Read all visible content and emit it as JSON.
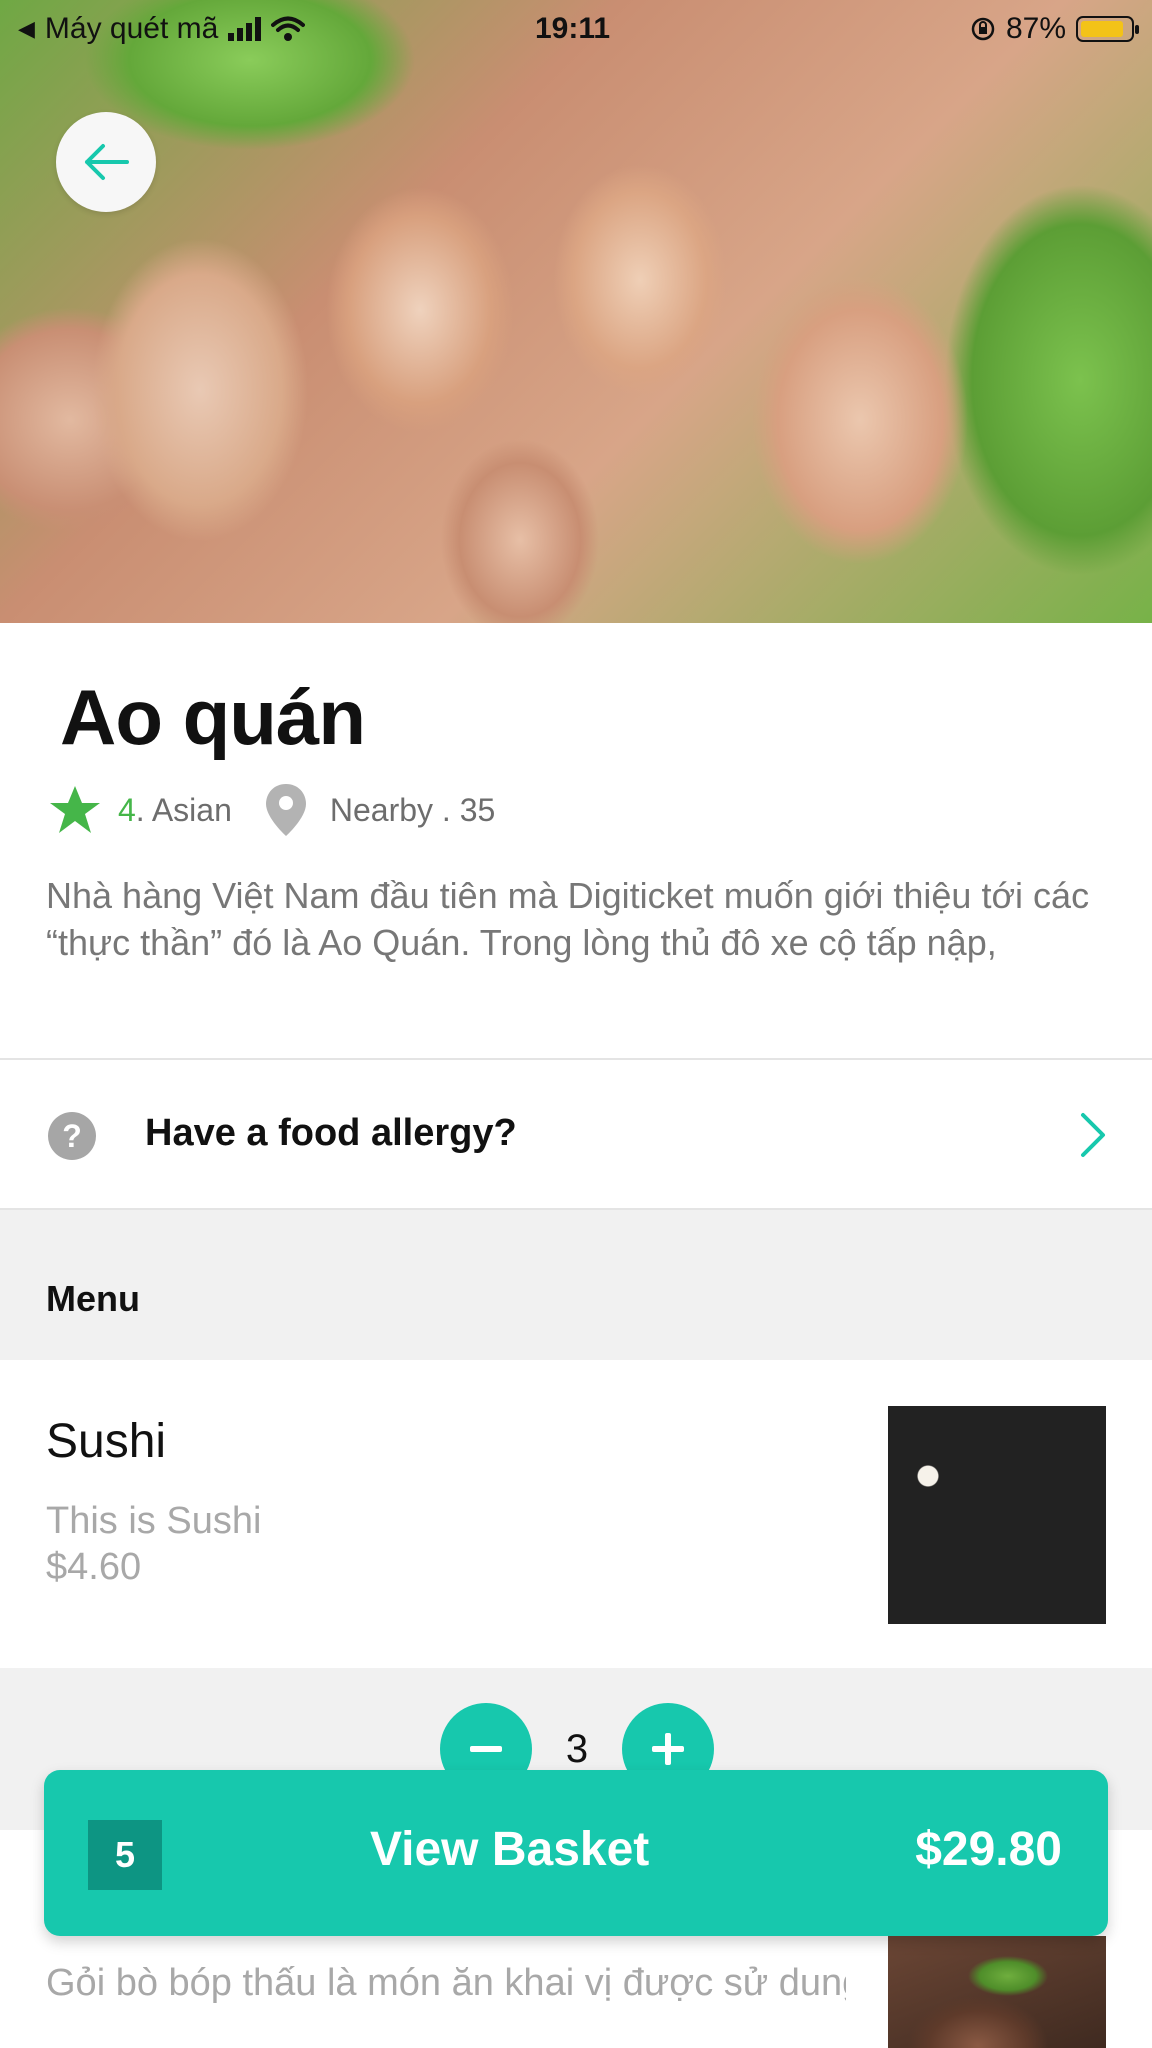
{
  "status_bar": {
    "back_app": "Máy quét mã",
    "time": "19:11",
    "battery": "87%",
    "battery_level": 0.87
  },
  "hero": {
    "image": "fish-steak-platter-photo"
  },
  "restaurant": {
    "name": "Ao quán",
    "rating": "4",
    "cuisine": " . Asian",
    "location": "Nearby . 35",
    "description": "Nhà hàng Việt Nam đầu tiên mà Digiticket muốn giới thiệu tới các “thực thần” đó là Ao Quán. Trong lòng thủ đô xe cộ tấp nập,"
  },
  "allergy": {
    "label": "Have a food allergy?",
    "icon": "?"
  },
  "menu": {
    "title": "Menu",
    "items": [
      {
        "name": "Sushi",
        "description": "This is Sushi",
        "price": "$4.60",
        "quantity": "3"
      },
      {
        "name": "",
        "description": "Gỏi bò bóp thấu là món ăn khai vị được sử dung phổ biến tai các nhà hàng để kích thíc..."
      }
    ]
  },
  "basket": {
    "count": "5",
    "label": "View Basket",
    "total": "$29.80"
  },
  "colors": {
    "accent": "#17c8ad",
    "rating_star": "#45b649",
    "text_muted": "#a8a8a8"
  }
}
